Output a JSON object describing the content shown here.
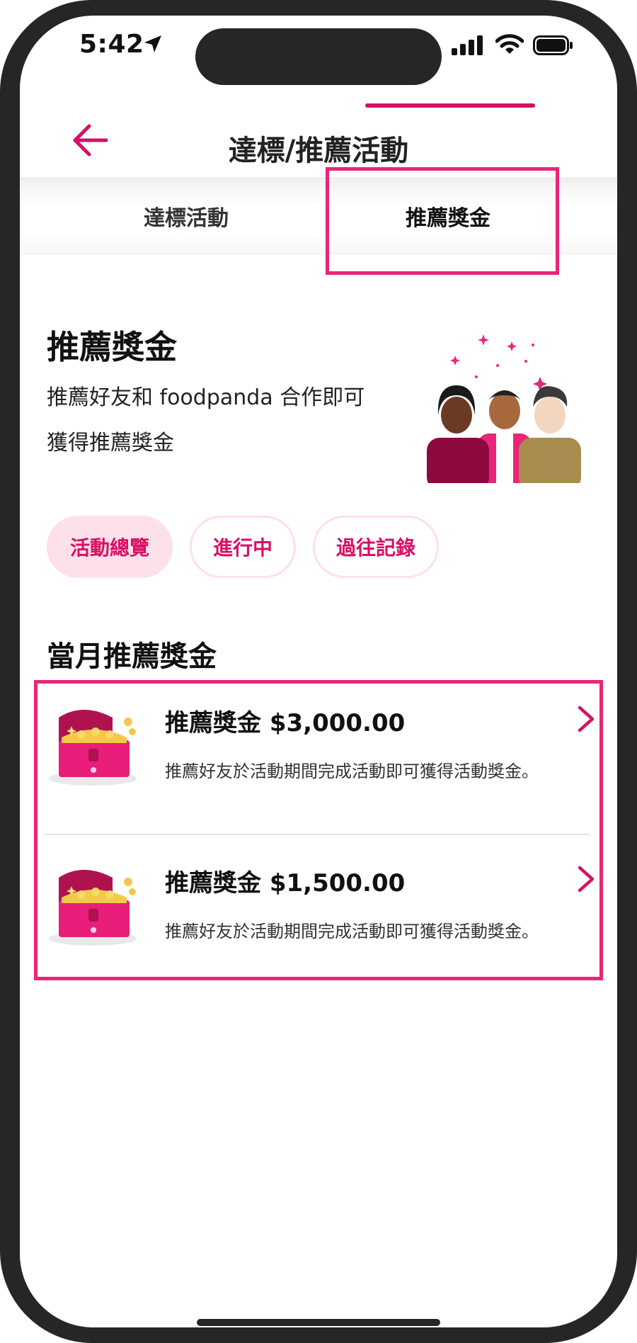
{
  "status_bar": {
    "time": "5:42"
  },
  "header": {
    "title": "達標/推薦活動"
  },
  "tabs": [
    {
      "label": "達標活動"
    },
    {
      "label": "推薦獎金"
    }
  ],
  "hero": {
    "title": "推薦獎金",
    "desc_line1": "推薦好友和 foodpanda 合作即可",
    "desc_line2": "獲得推薦獎金"
  },
  "filters": [
    {
      "label": "活動總覽"
    },
    {
      "label": "進行中"
    },
    {
      "label": "過往記錄"
    }
  ],
  "section": {
    "title": "當月推薦獎金"
  },
  "rewards": [
    {
      "title": "推薦獎金 $3,000.00",
      "desc": "推薦好友於活動期間完成活動即可獲得活動獎金。"
    },
    {
      "title": "推薦獎金 $1,500.00",
      "desc": "推薦好友於活動期間完成活動即可獲得活動獎金。"
    }
  ],
  "colors": {
    "brand": "#d70f64",
    "highlight": "#e9257b",
    "chip_bg": "#fde0ea"
  },
  "icons": [
    "location-arrow-icon",
    "signal-icon",
    "wifi-icon",
    "battery-icon",
    "back-arrow-icon",
    "chevron-right-icon",
    "treasure-chest-icon"
  ]
}
